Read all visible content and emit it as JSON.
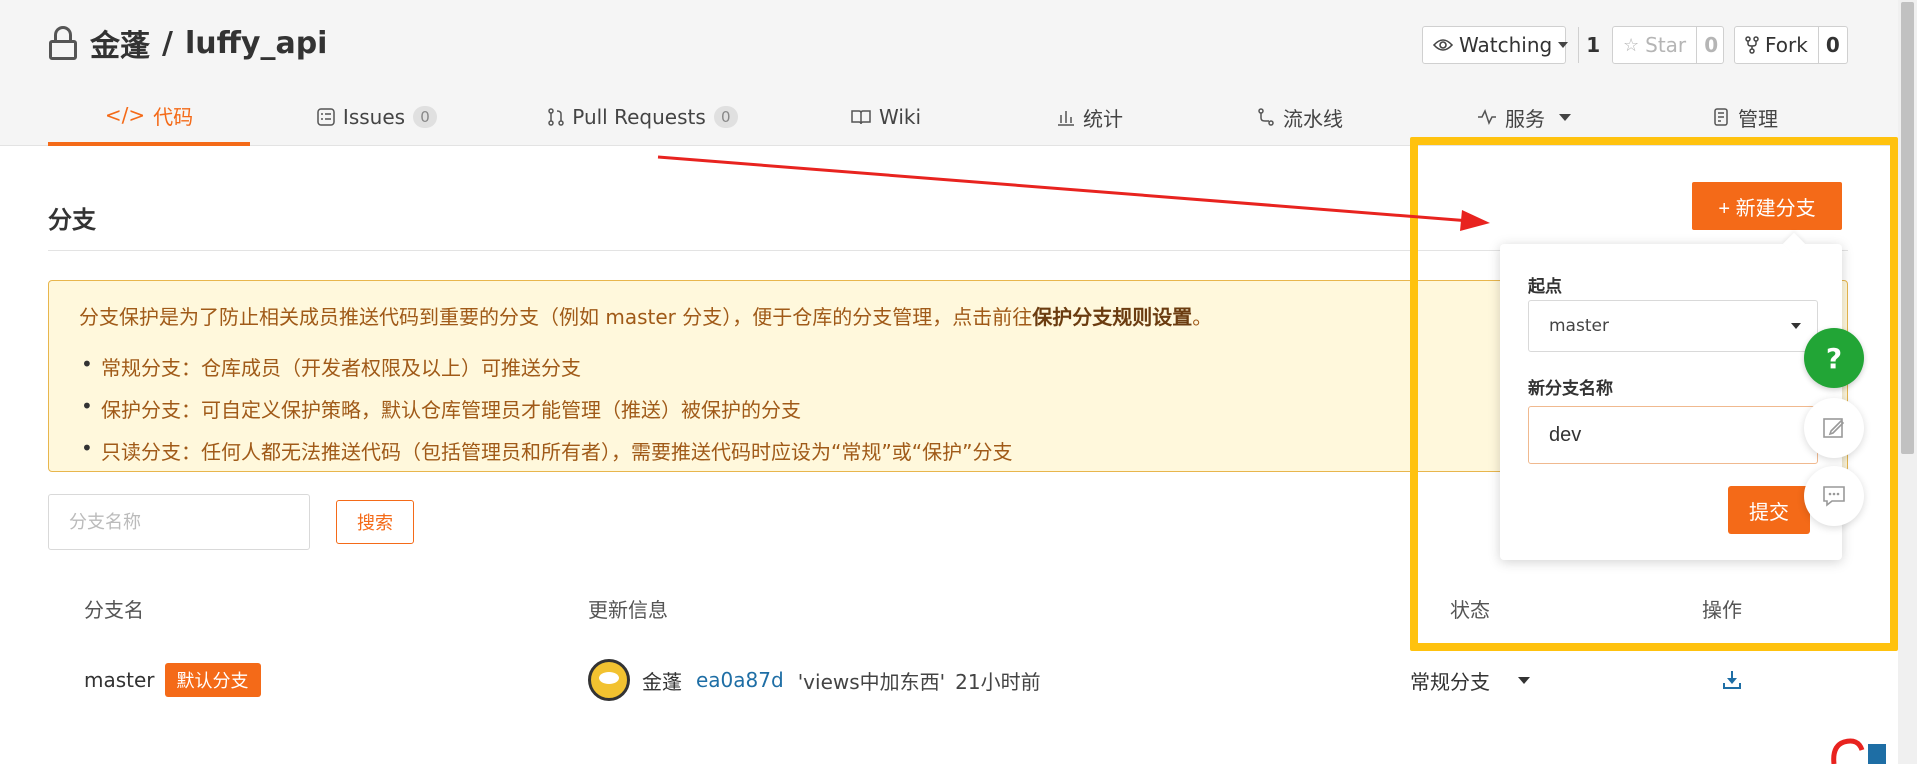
{
  "header": {
    "owner": "金蓬",
    "separator": "/",
    "repo": "luffy_api",
    "watch": {
      "label": "Watching",
      "count": "1"
    },
    "star": {
      "label": "Star",
      "count": "0"
    },
    "fork": {
      "label": "Fork",
      "count": "0"
    }
  },
  "tabs": [
    {
      "icon": "</>",
      "label": "代码"
    },
    {
      "label": "Issues",
      "badge": "0"
    },
    {
      "label": "Pull Requests",
      "badge": "0"
    },
    {
      "label": "Wiki"
    },
    {
      "label": "统计"
    },
    {
      "label": "流水线"
    },
    {
      "label": "服务"
    },
    {
      "label": "管理"
    }
  ],
  "section": {
    "title": "分支",
    "notice_lead": "分支保护是为了防止相关成员推送代码到重要的分支（例如 master 分支），便于仓库的分支管理，点击前往",
    "notice_link": "保护分支规则设置",
    "notice_end": "。",
    "notice_items": [
      "常规分支：仓库成员（开发者权限及以上）可推送分支",
      "保护分支：可自定义保护策略，默认仓库管理员才能管理（推送）被保护的分支",
      "只读分支：任何人都无法推送代码（包括管理员和所有者），需要推送代码时应设为“常规”或“保护”分支"
    ],
    "search_placeholder": "分支名称",
    "search_button": "搜索"
  },
  "table": {
    "headers": [
      "分支名",
      "更新信息",
      "状态",
      "操作"
    ],
    "rows": [
      {
        "branch": "master",
        "badge": "默认分支",
        "author": "金蓬",
        "commit": "ea0a87d",
        "message": "'views中加东西'",
        "time": "21小时前",
        "status": "常规分支"
      }
    ]
  },
  "new_branch": {
    "button": "+ 新建分支",
    "start_label": "起点",
    "start_value": "master",
    "name_label": "新分支名称",
    "name_value": "dev",
    "submit": "提交"
  },
  "floating": {
    "help": "?"
  },
  "colors": {
    "accent": "#f46a18",
    "highlight": "#ffc20e",
    "arrow": "#e8231f",
    "help": "#22a536"
  }
}
